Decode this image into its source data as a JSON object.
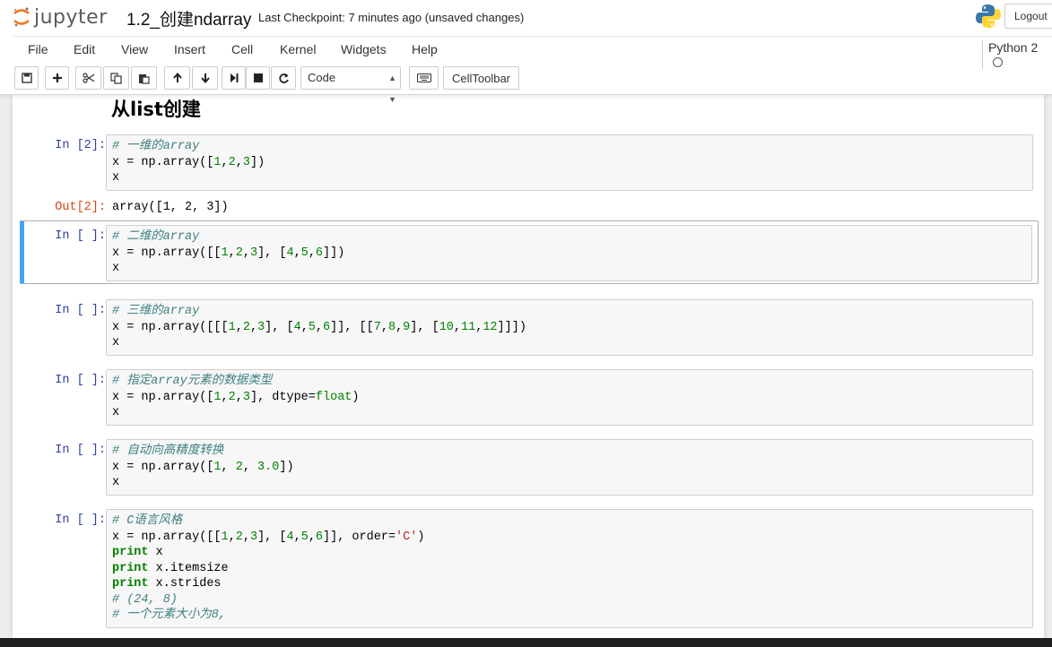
{
  "header": {
    "logo_text": "jupyter",
    "notebook_name": "1.2_创建ndarray",
    "checkpoint": "Last Checkpoint: 7 minutes ago (unsaved changes)",
    "logout_label": "Logout"
  },
  "menu": {
    "items": [
      "File",
      "Edit",
      "View",
      "Insert",
      "Cell",
      "Kernel",
      "Widgets",
      "Help"
    ],
    "kernel_name": "Python 2"
  },
  "toolbar": {
    "cell_type": "Code",
    "cell_toolbar_label": "CellToolbar"
  },
  "notebook": {
    "heading": "从list创建",
    "cells": [
      {
        "prompt": "In [2]:",
        "lines": [
          [
            [
              "cm",
              "# 一维的array"
            ]
          ],
          [
            [
              "t",
              "x = np.array(["
            ],
            [
              "num",
              "1"
            ],
            [
              "t",
              ","
            ],
            [
              "num",
              "2"
            ],
            [
              "t",
              ","
            ],
            [
              "num",
              "3"
            ],
            [
              "t",
              "])"
            ]
          ],
          [
            [
              "t",
              "x"
            ]
          ]
        ],
        "output_prompt": "Out[2]:",
        "output": "array([1, 2, 3])"
      },
      {
        "prompt": "In [ ]:",
        "selected": true,
        "lines": [
          [
            [
              "cm",
              "# 二维的array"
            ]
          ],
          [
            [
              "t",
              "x = np.array([["
            ],
            [
              "num",
              "1"
            ],
            [
              "t",
              ","
            ],
            [
              "num",
              "2"
            ],
            [
              "t",
              ","
            ],
            [
              "num",
              "3"
            ],
            [
              "t",
              "], ["
            ],
            [
              "num",
              "4"
            ],
            [
              "t",
              ","
            ],
            [
              "num",
              "5"
            ],
            [
              "t",
              ","
            ],
            [
              "num",
              "6"
            ],
            [
              "t",
              "]])"
            ]
          ],
          [
            [
              "t",
              "x"
            ]
          ]
        ]
      },
      {
        "prompt": "In [ ]:",
        "lines": [
          [
            [
              "cm",
              "# 三维的array"
            ]
          ],
          [
            [
              "t",
              "x = np.array([[["
            ],
            [
              "num",
              "1"
            ],
            [
              "t",
              ","
            ],
            [
              "num",
              "2"
            ],
            [
              "t",
              ","
            ],
            [
              "num",
              "3"
            ],
            [
              "t",
              "], ["
            ],
            [
              "num",
              "4"
            ],
            [
              "t",
              ","
            ],
            [
              "num",
              "5"
            ],
            [
              "t",
              ","
            ],
            [
              "num",
              "6"
            ],
            [
              "t",
              "]], [["
            ],
            [
              "num",
              "7"
            ],
            [
              "t",
              ","
            ],
            [
              "num",
              "8"
            ],
            [
              "t",
              ","
            ],
            [
              "num",
              "9"
            ],
            [
              "t",
              "], ["
            ],
            [
              "num",
              "10"
            ],
            [
              "t",
              ","
            ],
            [
              "num",
              "11"
            ],
            [
              "t",
              ","
            ],
            [
              "num",
              "12"
            ],
            [
              "t",
              "]]])"
            ]
          ],
          [
            [
              "t",
              "x"
            ]
          ]
        ]
      },
      {
        "prompt": "In [ ]:",
        "lines": [
          [
            [
              "cm",
              "# 指定array元素的数据类型"
            ]
          ],
          [
            [
              "t",
              "x = np.array(["
            ],
            [
              "num",
              "1"
            ],
            [
              "t",
              ","
            ],
            [
              "num",
              "2"
            ],
            [
              "t",
              ","
            ],
            [
              "num",
              "3"
            ],
            [
              "t",
              "], dtype="
            ],
            [
              "num",
              "float"
            ],
            [
              "t",
              ")"
            ]
          ],
          [
            [
              "t",
              "x"
            ]
          ]
        ]
      },
      {
        "prompt": "In [ ]:",
        "lines": [
          [
            [
              "cm",
              "# 自动向高精度转换"
            ]
          ],
          [
            [
              "t",
              "x = np.array(["
            ],
            [
              "num",
              "1"
            ],
            [
              "t",
              ", "
            ],
            [
              "num",
              "2"
            ],
            [
              "t",
              ", "
            ],
            [
              "num",
              "3.0"
            ],
            [
              "t",
              "])"
            ]
          ],
          [
            [
              "t",
              "x"
            ]
          ]
        ]
      },
      {
        "prompt": "In [ ]:",
        "lines": [
          [
            [
              "cm",
              "# C语言风格"
            ]
          ],
          [
            [
              "t",
              "x = np.array([["
            ],
            [
              "num",
              "1"
            ],
            [
              "t",
              ","
            ],
            [
              "num",
              "2"
            ],
            [
              "t",
              ","
            ],
            [
              "num",
              "3"
            ],
            [
              "t",
              "], ["
            ],
            [
              "num",
              "4"
            ],
            [
              "t",
              ","
            ],
            [
              "num",
              "5"
            ],
            [
              "t",
              ","
            ],
            [
              "num",
              "6"
            ],
            [
              "t",
              "]], order="
            ],
            [
              "str",
              "'C'"
            ],
            [
              "t",
              ")"
            ]
          ],
          [
            [
              "kw",
              "print"
            ],
            [
              "t",
              " x"
            ]
          ],
          [
            [
              "kw",
              "print"
            ],
            [
              "t",
              " x.itemsize"
            ]
          ],
          [
            [
              "kw",
              "print"
            ],
            [
              "t",
              " x.strides"
            ]
          ],
          [
            [
              "cm",
              "# (24, 8)"
            ]
          ],
          [
            [
              "cm",
              "# 一个元素大小为8,"
            ]
          ]
        ]
      }
    ]
  }
}
